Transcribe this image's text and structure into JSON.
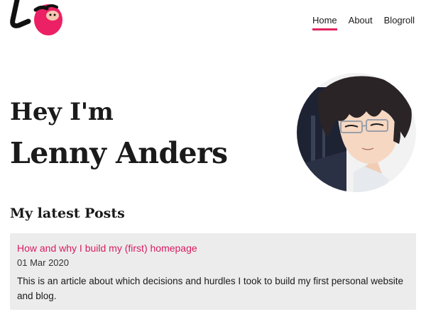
{
  "site": {
    "logo_icon": "sloth-logo-icon",
    "accent_color": "#e0245e"
  },
  "nav": {
    "items": [
      {
        "label": "Home",
        "active": true
      },
      {
        "label": "About",
        "active": false
      },
      {
        "label": "Blogroll",
        "active": false
      }
    ]
  },
  "hero": {
    "greeting": "Hey I'm",
    "name": "Lenny Anders",
    "avatar_icon": "avatar-portrait-icon"
  },
  "posts": {
    "heading": "My latest Posts",
    "items": [
      {
        "title": "How and why I build my (first) homepage",
        "date": "01 Mar 2020",
        "excerpt": "This is an article about which decisions and hurdles I took to build my first personal website and blog."
      }
    ]
  }
}
